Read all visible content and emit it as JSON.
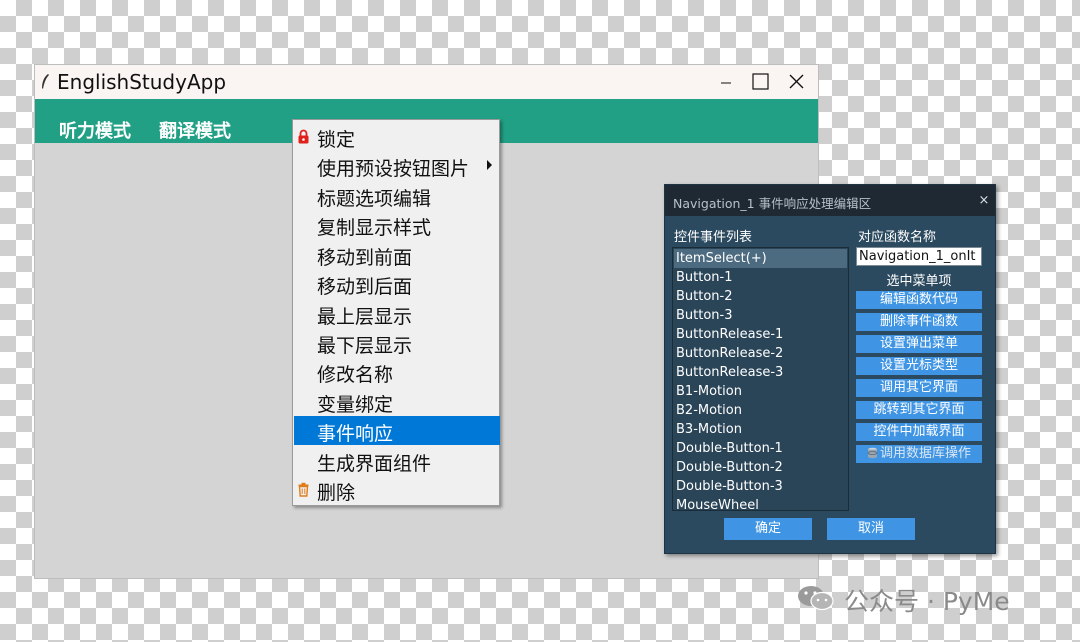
{
  "app": {
    "title": "EnglishStudyApp",
    "menubar": [
      "听力模式",
      "翻译模式"
    ]
  },
  "context_menu": {
    "items": [
      {
        "label": "锁定",
        "icon": "lock-icon"
      },
      {
        "label": "使用预设按钮图片",
        "submenu": true
      },
      {
        "label": "标题选项编辑"
      },
      {
        "label": "复制显示样式"
      },
      {
        "label": "移动到前面"
      },
      {
        "label": "移动到后面"
      },
      {
        "label": "最上层显示"
      },
      {
        "label": "最下层显示"
      },
      {
        "label": "修改名称"
      },
      {
        "label": "变量绑定"
      },
      {
        "label": "事件响应",
        "highlighted": true
      },
      {
        "label": "生成界面组件"
      },
      {
        "label": "删除",
        "icon": "trash-icon"
      }
    ]
  },
  "nav_dialog": {
    "title": "Navigation_1 事件响应处理编辑区",
    "close_glyph": "×",
    "events_header": "控件事件列表",
    "func_header": "对应函数名称",
    "events": [
      "ItemSelect(+)",
      "Button-1",
      "Button-2",
      "Button-3",
      "ButtonRelease-1",
      "ButtonRelease-2",
      "ButtonRelease-3",
      "B1-Motion",
      "B2-Motion",
      "B3-Motion",
      "Double-Button-1",
      "Double-Button-2",
      "Double-Button-3",
      "MouseWheel"
    ],
    "selected_event": "ItemSelect(+)",
    "func_name_value": "Navigation_1_onIt",
    "func_desc": "选中菜单项",
    "side_buttons": [
      "编辑函数代码",
      "删除事件函数",
      "设置弹出菜单",
      "设置光标类型",
      "调用其它界面",
      "跳转到其它界面",
      "控件中加载界面",
      "调用数据库操作"
    ],
    "ok_label": "确定",
    "cancel_label": "取消"
  },
  "watermark": {
    "text": "公众号 · PyMe"
  },
  "colors": {
    "menubar": "#21a085",
    "highlight": "#0078d7",
    "dialog_bg": "#2c4a5f",
    "dialog_button": "#3f94e3"
  }
}
